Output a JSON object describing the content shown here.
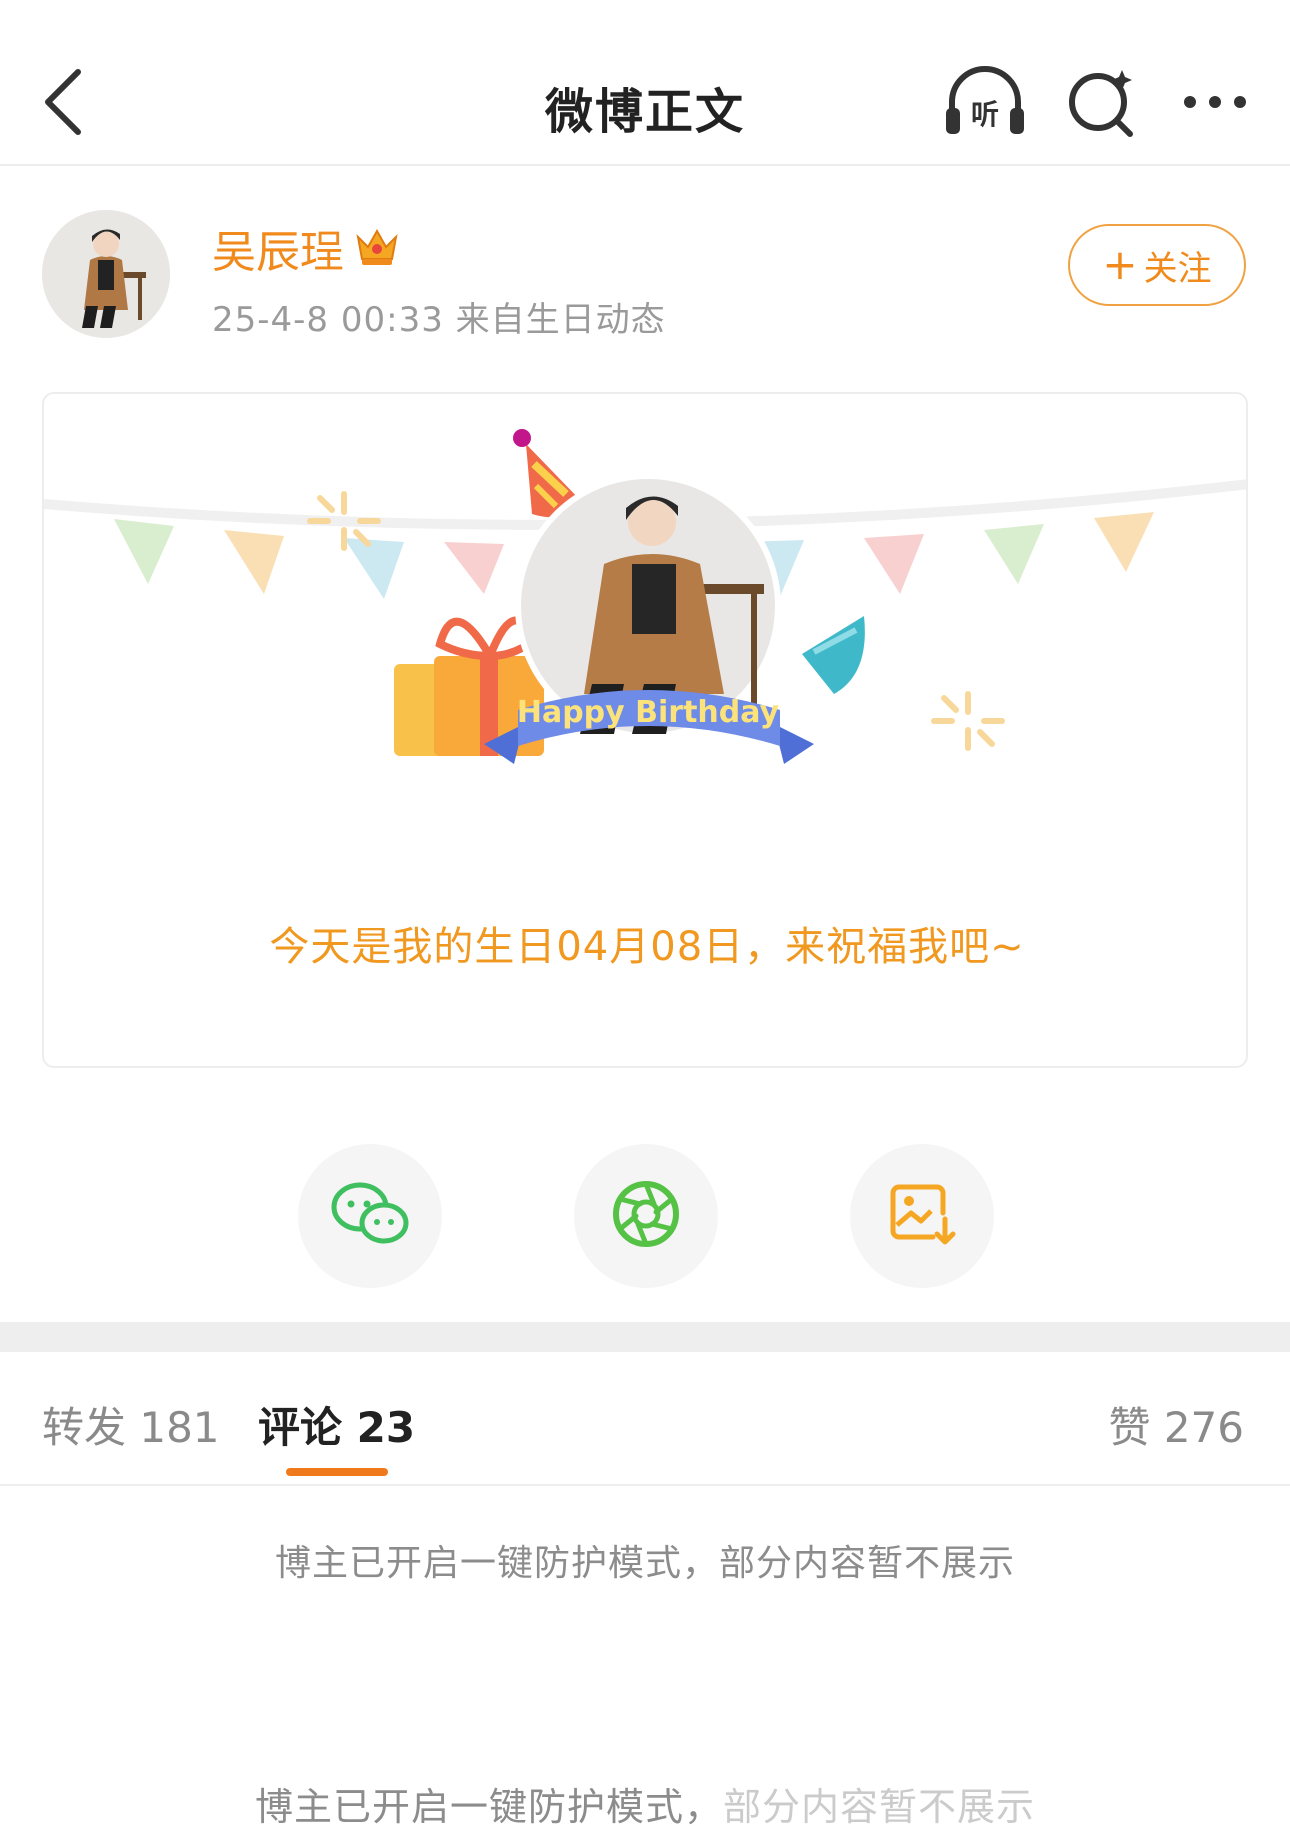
{
  "header": {
    "title": "微博正文",
    "icons": {
      "back": "back-chevron-icon",
      "listen": "listen-headphones-icon",
      "listen_label": "听",
      "search": "search-icon",
      "more": "more-dots-icon"
    }
  },
  "author": {
    "name": "吴辰珵",
    "badge": "crown-badge-icon",
    "meta": "25-4-8 00:33  来自生日动态",
    "follow_label": "关注",
    "follow_plus": "+"
  },
  "card": {
    "ribbon_text": "Happy Birthday",
    "message": "今天是我的生日04月08日，来祝福我吧~"
  },
  "share": {
    "icons": [
      "wechat-icon",
      "moments-icon",
      "save-image-icon"
    ]
  },
  "tabs": {
    "repost": "转发 181",
    "comments": "评论 23",
    "likes": "赞 276"
  },
  "notices": {
    "first": "博主已开启一键防护模式，部分内容暂不展示",
    "second": "博主已开启一键防护模式，部分内容暂不展示"
  },
  "colors": {
    "accent": "#f08a1d",
    "tab_underline": "#f07a1b",
    "card_text": "#f0981f",
    "wechat_green": "#3fbf5f",
    "moments_green": "#55c246",
    "save_orange": "#f5a623"
  }
}
